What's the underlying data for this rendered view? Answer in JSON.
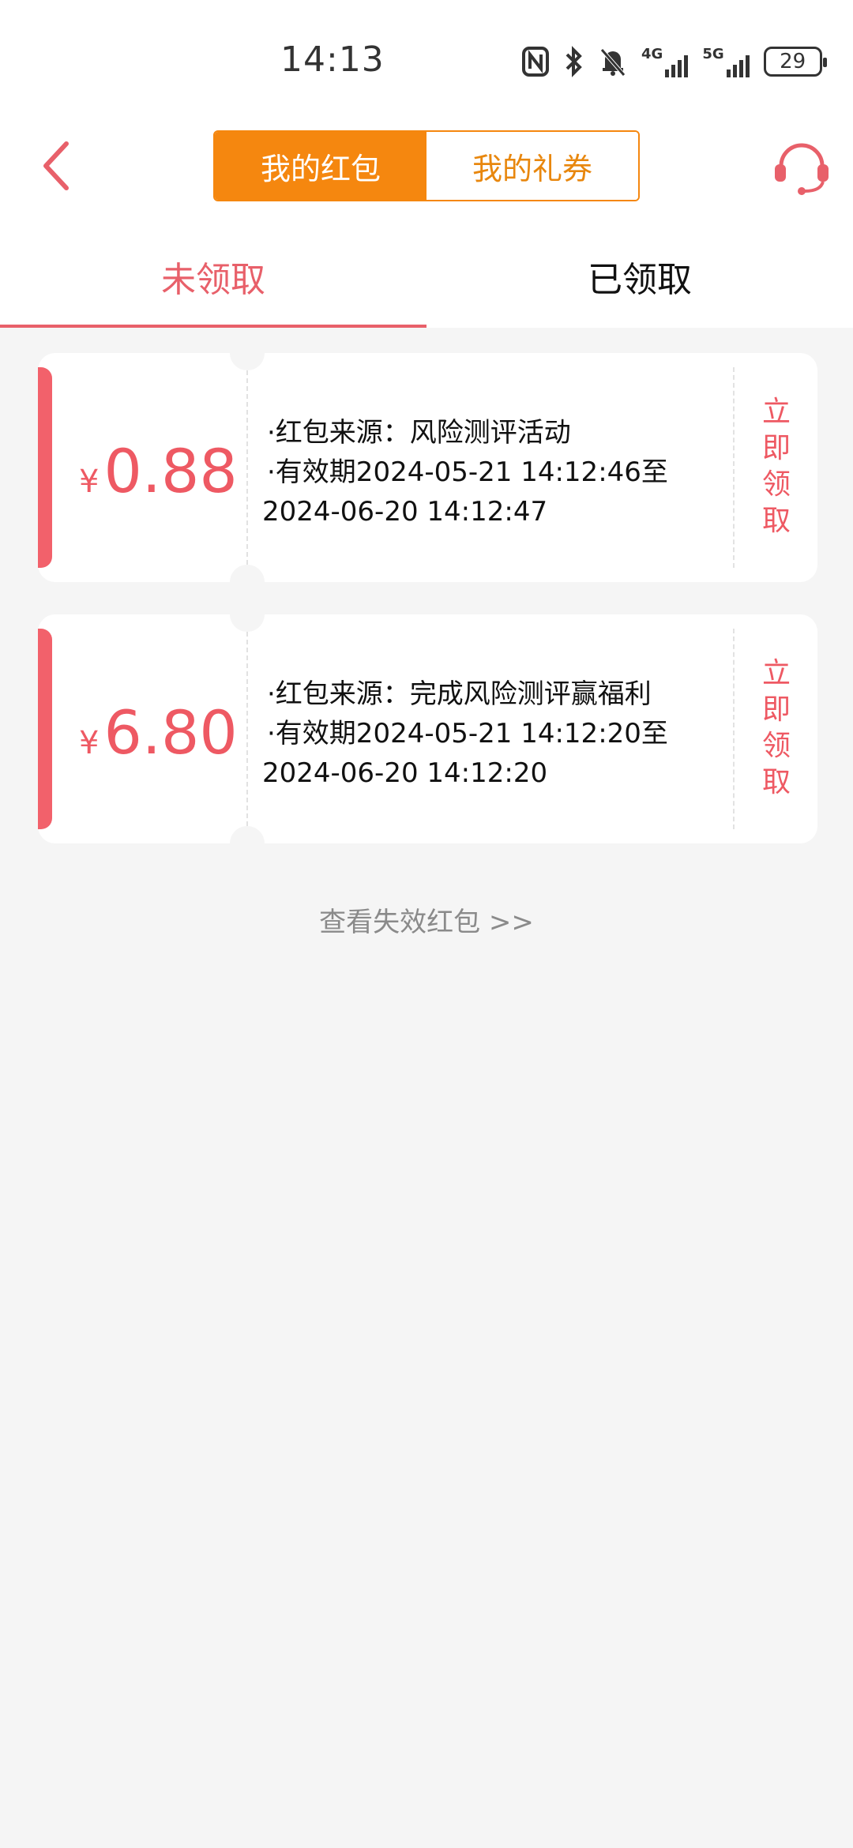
{
  "status_bar": {
    "time": "14:13",
    "icons": [
      "nfc-icon",
      "bluetooth-icon",
      "mute-bell-icon",
      "4g-signal-icon",
      "5g-signal-icon",
      "battery-icon"
    ],
    "network_4g": "4G",
    "network_5g": "5G",
    "battery_level": "29"
  },
  "header": {
    "segments": [
      "我的红包",
      "我的礼券"
    ],
    "active_segment": 0
  },
  "tabs": {
    "unclaimed": "未领取",
    "claimed": "已领取"
  },
  "coupons": [
    {
      "currency": "¥",
      "amount": "0.88",
      "source": "·红包来源：风险测评活动",
      "validity": "·有效期2024-05-21 14:12:46至",
      "validity_end": "2024-06-20 14:12:47",
      "claim_label": "立即领取"
    },
    {
      "currency": "¥",
      "amount": "6.80",
      "source": "·红包来源：完成风险测评赢福利",
      "validity": "·有效期2024-05-21 14:12:20至",
      "validity_end": "2024-06-20 14:12:20",
      "claim_label": "立即领取"
    }
  ],
  "expired_link": "查看失效红包 >>",
  "colors": {
    "accent_orange": "#f5870f",
    "accent_red": "#ee5963",
    "background": "#f5f5f5"
  }
}
